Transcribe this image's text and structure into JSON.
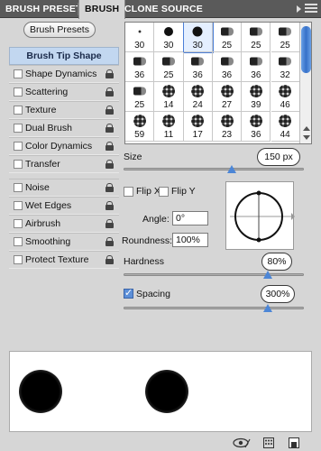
{
  "tabs": [
    {
      "label": "BRUSH PRESETS",
      "active": false
    },
    {
      "label": "BRUSH",
      "active": true
    },
    {
      "label": "CLONE SOURCE",
      "active": false
    }
  ],
  "presets_button": "Brush Presets",
  "sidebar": {
    "header": "Brush Tip Shape",
    "items": [
      {
        "label": "Shape Dynamics",
        "checked": false
      },
      {
        "label": "Scattering",
        "checked": false
      },
      {
        "label": "Texture",
        "checked": false
      },
      {
        "label": "Dual Brush",
        "checked": false
      },
      {
        "label": "Color Dynamics",
        "checked": false
      },
      {
        "label": "Transfer",
        "checked": false
      },
      {
        "label": "Noise",
        "checked": false
      },
      {
        "label": "Wet Edges",
        "checked": false
      },
      {
        "label": "Airbrush",
        "checked": false
      },
      {
        "label": "Smoothing",
        "checked": false
      },
      {
        "label": "Protect Texture",
        "checked": false
      }
    ]
  },
  "brush_grid": {
    "sizes": [
      "30",
      "30",
      "30",
      "25",
      "25",
      "25",
      "36",
      "25",
      "36",
      "36",
      "36",
      "32",
      "25",
      "14",
      "24",
      "27",
      "39",
      "46",
      "59",
      "11",
      "17",
      "23",
      "36",
      "44"
    ],
    "selected_index": 2
  },
  "size": {
    "label": "Size",
    "value": "150 px",
    "slider_fraction": 0.6
  },
  "flip_x": {
    "label": "Flip X",
    "checked": false
  },
  "flip_y": {
    "label": "Flip Y",
    "checked": false
  },
  "angle": {
    "label": "Angle:",
    "value": "0°"
  },
  "roundness": {
    "label": "Roundness:",
    "value": "100%"
  },
  "hardness": {
    "label": "Hardness",
    "value": "80%",
    "slider_fraction": 0.8
  },
  "spacing": {
    "label": "Spacing",
    "value": "300%",
    "checked": true,
    "slider_fraction": 0.8
  },
  "colors": {
    "accent": "#4c86d6",
    "header_bg": "#c2d7f0",
    "tabbar": "#5a5a5a"
  }
}
